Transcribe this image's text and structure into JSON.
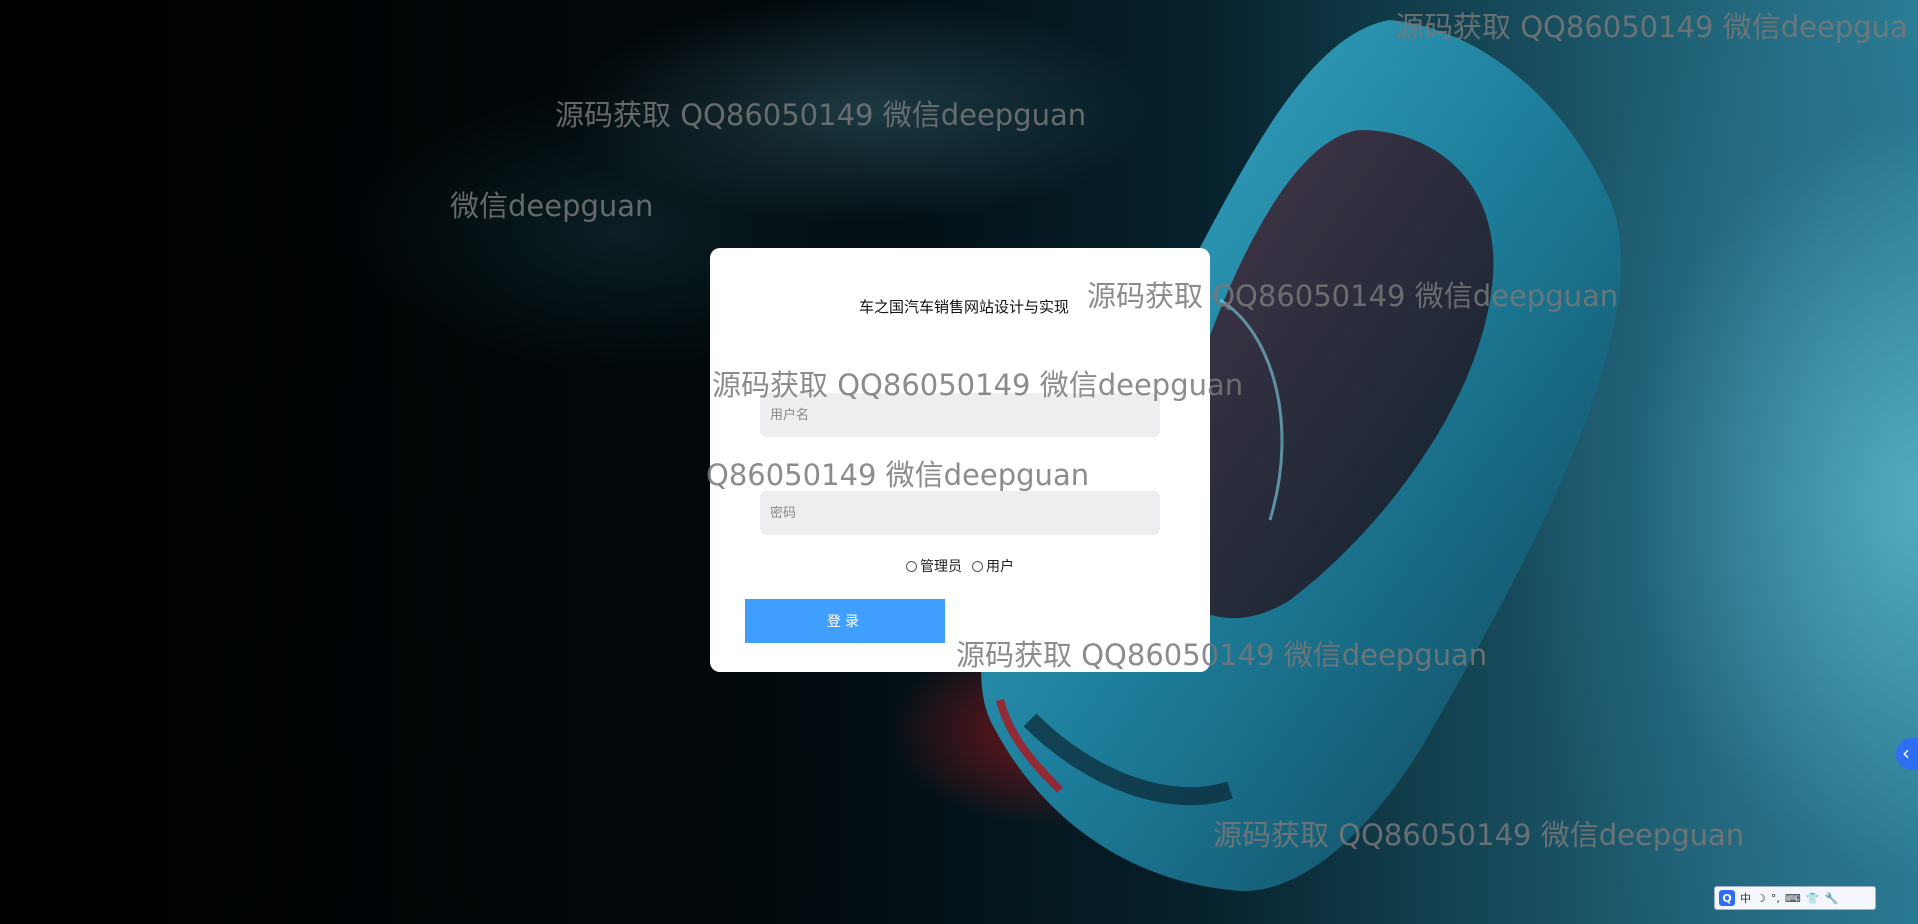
{
  "login": {
    "title": "车之国汽车销售网站设计与实现",
    "username_placeholder": "用户名",
    "password_placeholder": "密码",
    "roles": [
      "管理员",
      "用户"
    ],
    "submit_label": "登录"
  },
  "watermarks": [
    "源码获取 QQ86050149 微信deepgua",
    "源码获取 QQ86050149 微信deepguan",
    "微信deepguan",
    "源码获取 QQ86050149 微信deepguan",
    "源码获取 QQ86050149 微信deepguan",
    "Q86050149 微信deepguan",
    "源码获取 QQ86050149 微信deepguan",
    "源码获取 QQ86050149 微信deepguan"
  ],
  "side_toggle": {
    "icon": "chevron-left-icon",
    "glyph": "‹"
  },
  "ime_toolbar": {
    "logo": "Q",
    "items": [
      "中",
      "☽",
      "°,",
      "⌨",
      "👕",
      "🔧"
    ]
  },
  "colors": {
    "primary_button": "#409eff",
    "card_background": "#ffffff",
    "input_background": "#eeeef0",
    "watermark": "#787878"
  }
}
